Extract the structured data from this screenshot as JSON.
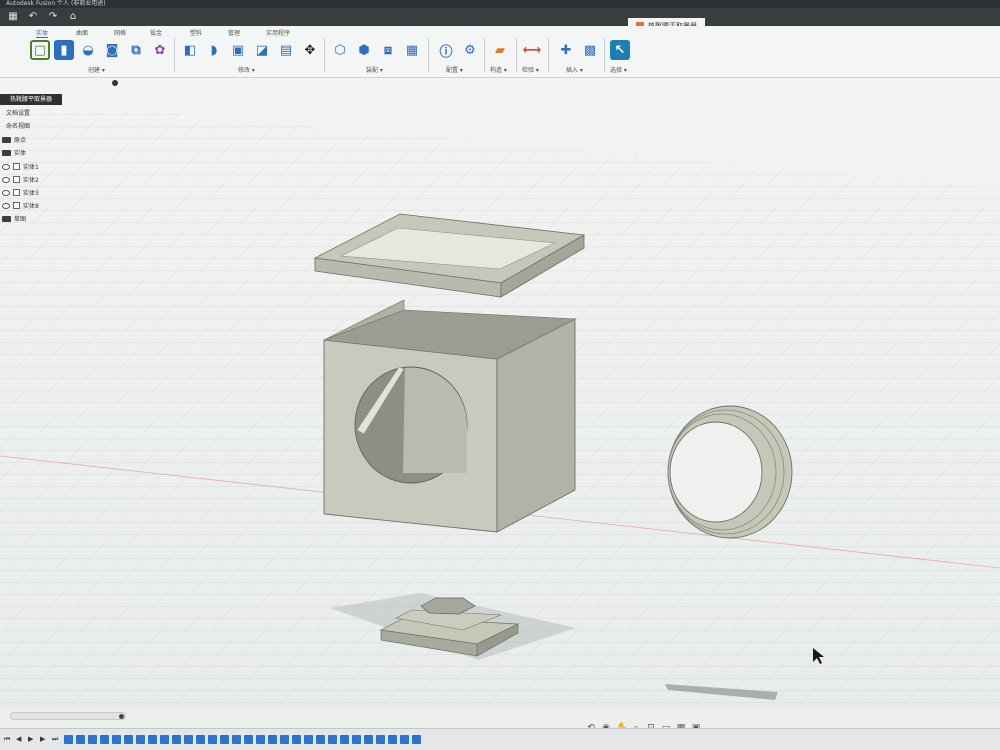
{
  "app": {
    "title": "Autodesk Fusion 个人 (非商业用途)",
    "document_title": "热靴腰平取景器"
  },
  "ribbon": {
    "tabs": [
      "实体",
      "曲面",
      "网格",
      "钣金",
      "塑料",
      "管理",
      "实用程序"
    ],
    "active_tab": "实体",
    "groups": [
      "创建 ▾",
      "修改 ▾",
      "装配 ▾",
      "配置 ▾",
      "构造 ▾",
      "检验 ▾",
      "插入 ▾",
      "选择 ▾"
    ]
  },
  "browser": {
    "root": "热靴腰平取景器",
    "items": [
      {
        "label": "文档设置",
        "kind": "settings"
      },
      {
        "label": "命名视图",
        "kind": "settings"
      },
      {
        "label": "原点",
        "kind": "folder"
      },
      {
        "label": "实体",
        "kind": "folder"
      },
      {
        "label": "实体1",
        "kind": "body"
      },
      {
        "label": "实体2",
        "kind": "body"
      },
      {
        "label": "实体3",
        "kind": "body"
      },
      {
        "label": "实体8",
        "kind": "body"
      },
      {
        "label": "草图",
        "kind": "folder"
      }
    ]
  },
  "colors": {
    "model_face": "#c4c8b8",
    "model_dark": "#9ea296",
    "accent": "#1b6fc2",
    "grid": "#c9cfd0"
  }
}
